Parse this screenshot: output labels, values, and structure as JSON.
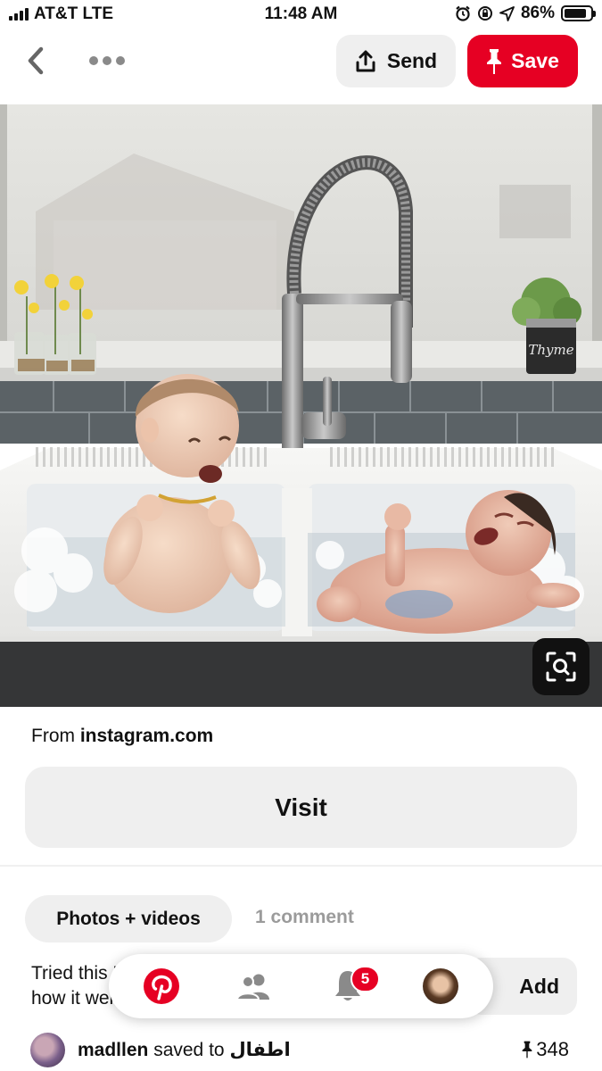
{
  "status_bar": {
    "carrier": "AT&T LTE",
    "time": "11:48 AM",
    "battery": "86%",
    "battery_level": 0.86,
    "icons": [
      "signal-bars-icon",
      "alarm-icon",
      "rotation-lock-icon",
      "location-arrow-icon",
      "battery-icon"
    ]
  },
  "header": {
    "back_icon": "chevron-left-icon",
    "more_icon": "more-dots-icon",
    "send_label": "Send",
    "send_icon": "share-upload-icon",
    "save_label": "Save",
    "save_icon": "pushpin-icon"
  },
  "pin": {
    "image_text": "Thyme",
    "lens_icon": "visual-search-icon"
  },
  "source": {
    "prefix": "From ",
    "domain": "instagram.com",
    "visit_label": "Visit"
  },
  "tabs": {
    "active": "Photos + videos",
    "inactive": "1 comment"
  },
  "tried": {
    "line1": "Tried this Pin? Add a photo to show",
    "line2": "how it went",
    "add_label": "Add",
    "add_icon": "camera-icon"
  },
  "saved_by": {
    "user": "madllen",
    "action": "saved to",
    "board": "اطفال",
    "save_count": "348",
    "count_icon": "pushpin-icon"
  },
  "bottom_nav": {
    "items": [
      "pinterest-logo-icon",
      "people-icon",
      "bell-icon",
      "profile-avatar"
    ],
    "notification_count": "5"
  },
  "colors": {
    "brand_red": "#e60023",
    "button_gray": "#efefef",
    "muted_text": "#9b9b9b"
  }
}
